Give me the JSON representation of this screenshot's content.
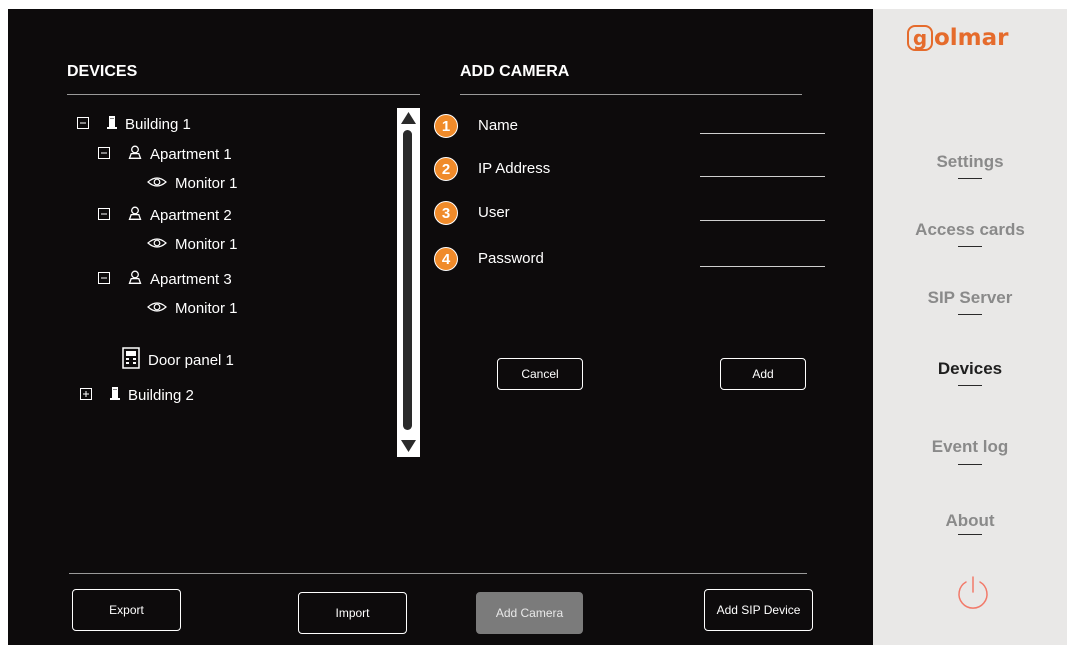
{
  "devices": {
    "heading": "DEVICES",
    "tree": [
      {
        "label": "Building 1",
        "icon": "building-icon",
        "toggle": "⊟"
      },
      {
        "label": "Apartment 1",
        "icon": "person-icon",
        "toggle": "⊟"
      },
      {
        "label": "Monitor 1",
        "icon": "eye-icon"
      },
      {
        "label": "Apartment 2",
        "icon": "person-icon",
        "toggle": "⊟"
      },
      {
        "label": "Monitor 1",
        "icon": "eye-icon"
      },
      {
        "label": "Apartment 3",
        "icon": "person-icon",
        "toggle": "⊟"
      },
      {
        "label": "Monitor 1",
        "icon": "eye-icon"
      },
      {
        "label": "Door panel 1",
        "icon": "door-panel-icon"
      },
      {
        "label": "Building 2",
        "icon": "building-icon",
        "toggle": "⊞"
      }
    ]
  },
  "add_camera": {
    "heading": "ADD CAMERA",
    "fields": [
      {
        "num": "1",
        "label": "Name",
        "value": ""
      },
      {
        "num": "2",
        "label": "IP Address",
        "value": ""
      },
      {
        "num": "3",
        "label": "User",
        "value": ""
      },
      {
        "num": "4",
        "label": "Password",
        "value": ""
      }
    ],
    "cancel_label": "Cancel",
    "add_label": "Add"
  },
  "bottom_bar": {
    "export_label": "Export",
    "import_label": "Import",
    "add_camera_label": "Add Camera",
    "add_sip_label": "Add SIP Device"
  },
  "sidebar": {
    "logo": "olmar",
    "logo_badge": "g",
    "items": [
      {
        "label": "Settings",
        "active": false
      },
      {
        "label": "Access cards",
        "active": false
      },
      {
        "label": "SIP Server",
        "active": false
      },
      {
        "label": "Devices",
        "active": true
      },
      {
        "label": "Event log",
        "active": false
      },
      {
        "label": "About",
        "active": false
      }
    ],
    "power_icon": "power-icon"
  },
  "colors": {
    "accent": "#f08b2a",
    "background": "#0d0b0c",
    "sidebar": "#e9e8e7"
  }
}
